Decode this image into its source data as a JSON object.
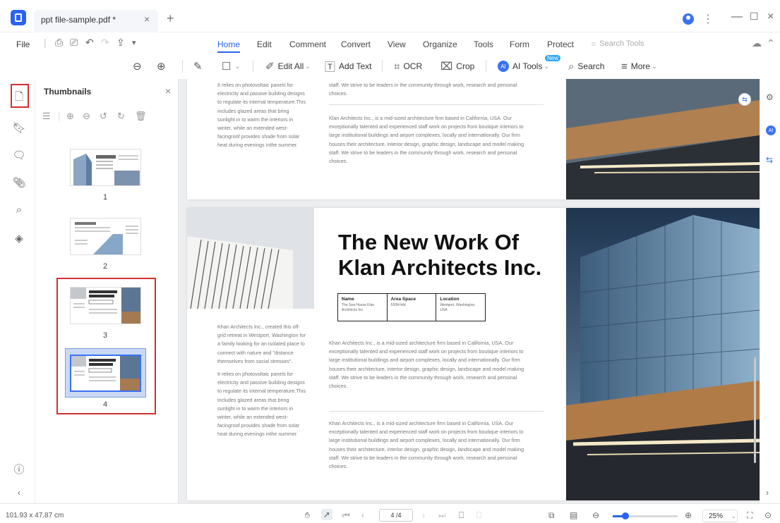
{
  "tab": {
    "title": "ppt file-sample.pdf *"
  },
  "menu": {
    "file": "File",
    "tabs": [
      "Home",
      "Edit",
      "Comment",
      "Convert",
      "View",
      "Organize",
      "Tools",
      "Form",
      "Protect"
    ],
    "search_tools": "Search Tools"
  },
  "toolbar": {
    "edit_all": "Edit All",
    "add_text": "Add Text",
    "ocr": "OCR",
    "crop": "Crop",
    "ai_tools": "AI Tools",
    "ai_badge": "New",
    "search": "Search",
    "more": "More"
  },
  "thumbnails": {
    "title": "Thumbnails",
    "pages": [
      "1",
      "2",
      "3",
      "4"
    ],
    "selected_page": "4"
  },
  "page3": {
    "col1_lines": [
      "It relies on photovoltaic panels for",
      "electricity and passive building designs",
      "to regulate its internal temperature.This",
      "includes glazed areas that bring",
      "sunlight in to warm the interiors in",
      "winter, while an extended west-",
      "facingroof provides shade from solar",
      "heat during evenings inthe summer."
    ],
    "col2a_lines": [
      "staff. We strive to be leaders in the community through work, research and personal",
      "choices."
    ],
    "col2b_lines": [
      "Klan Architects Inc., is a mid-sized architecture firm based in California, USA. Our",
      "exceptionally talented and experienced staff work on projects from boutique interiors to",
      "large institutional buildings and airport complexes, locally and internationally. Our firm",
      "houses their architecture, interior design, graphic design, landscape and model making",
      "staff. We strive to be leaders in the community through work, research and personal",
      "choices."
    ]
  },
  "page4": {
    "title_line1": "The New Work Of",
    "title_line2": "Klan Architects Inc.",
    "info": {
      "name_label": "Name",
      "name_value": "The Sea House Klan Architects Inc.",
      "area_label": "Area Space",
      "area_value": "550ft²/sfd",
      "location_label": "Location",
      "location_value": "Westport, Washington, USA"
    },
    "col1_lines": [
      "Khan Architects Inc., created this off-",
      "grid retreat in Westport, Washington for",
      "a family looking for an isolated place to",
      "connect with nature and \"distance",
      "themselves from social stresses\".",
      "",
      "It relies on photovoltaic panels for",
      "electricity and passive building designs",
      "to regulate its internal temperature.This",
      "includes glazed areas that bring",
      "sunlight in to warm the interiors in",
      "winter, while an extended west-",
      "facingroof provides shade from solar",
      "heat during evenings inthe summer."
    ],
    "col2a_lines": [
      "Khan Architects Inc., is a mid-sized architecture firm based in California, USA. Our",
      "exceptionally talented and experienced staff work on projects from boutique interiors to",
      "large institutional buildings and airport complexes, locally and internationally. Our firm",
      "houses their architecture, interior design, graphic design, landscape and model making",
      "staff. We strive to be leaders in the community through work, research and personal",
      "choices."
    ],
    "col2b_lines": [
      "Khan Architects Inc., is a mid-sized architecture firm based in California, USA. Our",
      "exceptionally talented and experienced staff work on projects from boutique interiors to",
      "large institutional buildings and airport complexes, locally and internationally. Our firm",
      "houses their architecture, interior design, graphic design, landscape and model making",
      "staff. We strive to be leaders in the community through work, research and personal",
      "choices."
    ]
  },
  "status": {
    "dimensions": "101.93 x 47.87 cm",
    "page_input": "4 /4",
    "zoom": "25%",
    "zoom_fraction": 0.2
  },
  "colors": {
    "accent": "#2a63f2",
    "highlight_box": "#d32f2f",
    "doc_background": "#edeef0"
  }
}
